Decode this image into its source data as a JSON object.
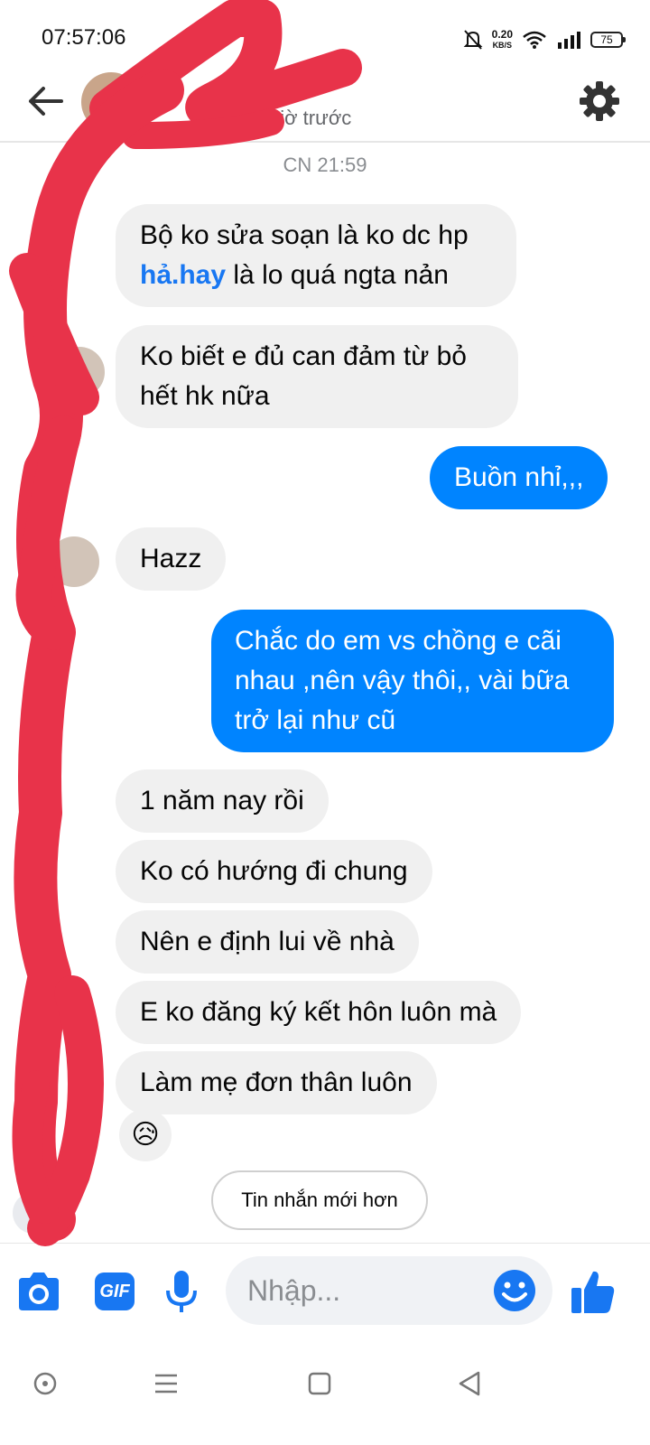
{
  "status_bar": {
    "time": "07:57:06",
    "net_speed_value": "0.20",
    "net_speed_unit": "KB/S",
    "battery_level": "75"
  },
  "header": {
    "contact_name": "",
    "contact_status": "giờ trước",
    "icons": {
      "back": "arrow-left-icon",
      "settings": "gear-icon"
    }
  },
  "conversation": {
    "time_separator": "CN 21:59",
    "messages": [
      {
        "from": "them",
        "line1": "Bộ ko sửa soạn là ko dc hp",
        "link": "hả.hay",
        "line2_rest": " là lo quá ngta nản"
      },
      {
        "from": "them",
        "line1": "Ko biết e đủ can đảm từ bỏ",
        "line2": "hết hk nữa"
      },
      {
        "from": "me",
        "text": "Buồn nhỉ,,,"
      },
      {
        "from": "them",
        "text": "Hazz"
      },
      {
        "from": "me",
        "line1": "Chắc do em vs chồng e cãi",
        "line2": "nhau ,nên vậy thôi,, vài bữa",
        "line3": "trở lại như cũ"
      },
      {
        "from": "them",
        "text": "1 năm nay rồi"
      },
      {
        "from": "them",
        "text": "Ko có hướng đi chung"
      },
      {
        "from": "them",
        "text": "Nên e định lui về nhà"
      },
      {
        "from": "them",
        "text": "E ko đăng ký kết hôn luôn mà"
      },
      {
        "from": "them",
        "text": "Làm mẹ đơn thân luôn"
      }
    ],
    "reaction_emoji": "😥",
    "newer_messages_button": "Tin nhắn mới hơn"
  },
  "composer": {
    "placeholder": "Nhập...",
    "gif_label": "GIF",
    "icons": {
      "camera": "camera-icon",
      "gif": "gif-icon",
      "mic": "microphone-icon",
      "emoji": "smiley-icon",
      "like": "thumbs-up-icon"
    }
  },
  "navbar": {
    "icons": [
      "home-circle-icon",
      "menu-lines-icon",
      "square-icon",
      "back-triangle-icon"
    ]
  },
  "colors": {
    "outgoing_bubble": "#0084ff",
    "incoming_bubble": "#f0f0f0",
    "accent": "#1877f2",
    "scribble": "#e8334a"
  }
}
